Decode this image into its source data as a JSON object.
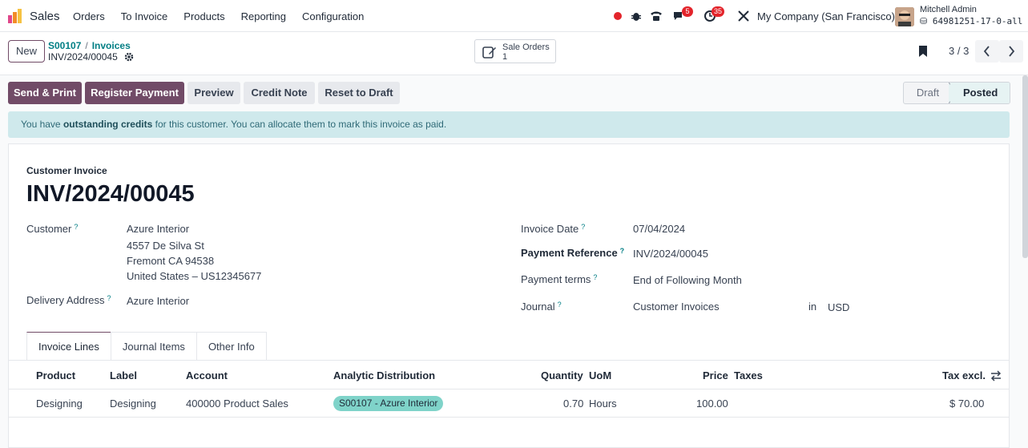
{
  "navbar": {
    "app_name": "Sales",
    "menu": [
      "Orders",
      "To Invoice",
      "Products",
      "Reporting",
      "Configuration"
    ],
    "discuss_badge": "5",
    "activity_badge": "35",
    "company": "My Company (San Francisco)",
    "user_name": "Mitchell Admin",
    "db_name": "64981251-17-0-all"
  },
  "control": {
    "new_label": "New",
    "breadcrumb": [
      "S00107",
      "Invoices"
    ],
    "breadcrumb_sep": "/",
    "record_name": "INV/2024/00045",
    "smart_button": {
      "label": "Sale Orders",
      "count": "1"
    },
    "pager": "3 / 3"
  },
  "actions": {
    "send_print": "Send & Print",
    "register_payment": "Register Payment",
    "preview": "Preview",
    "credit_note": "Credit Note",
    "reset_to_draft": "Reset to Draft"
  },
  "statusbar": {
    "draft": "Draft",
    "posted": "Posted"
  },
  "alert": {
    "before": "You have ",
    "strong": "outstanding credits",
    "after": " for this customer. You can allocate them to mark this invoice as paid."
  },
  "form": {
    "doc_type": "Customer Invoice",
    "doc_name": "INV/2024/00045",
    "customer_label": "Customer",
    "customer": "Azure Interior",
    "address": [
      "4557 De Silva St",
      "Fremont CA 94538",
      "United States – US12345677"
    ],
    "delivery_label": "Delivery Address",
    "delivery": "Azure Interior",
    "invoice_date_label": "Invoice Date",
    "invoice_date": "07/04/2024",
    "payment_ref_label": "Payment Reference",
    "payment_ref": "INV/2024/00045",
    "payment_terms_label": "Payment terms",
    "payment_terms": "End of Following Month",
    "journal_label": "Journal",
    "journal": "Customer Invoices",
    "in_label": "in",
    "currency": "USD",
    "help_mark": "?"
  },
  "tabs": [
    "Invoice Lines",
    "Journal Items",
    "Other Info"
  ],
  "lines": {
    "headers": {
      "product": "Product",
      "label": "Label",
      "account": "Account",
      "analytic": "Analytic Distribution",
      "quantity": "Quantity",
      "uom": "UoM",
      "price": "Price",
      "taxes": "Taxes",
      "tax_excl": "Tax excl."
    },
    "rows": [
      {
        "product": "Designing",
        "label": "Designing",
        "account": "400000 Product Sales",
        "analytic": "S00107 - Azure Interior",
        "quantity": "0.70",
        "uom": "Hours",
        "price": "100.00",
        "taxes": "",
        "tax_excl": "$ 70.00"
      }
    ]
  },
  "colors": {
    "brand": "#714b67",
    "link": "#017e84",
    "alert_bg": "#cfe9ec",
    "tag_bg": "#7fd3c9"
  }
}
